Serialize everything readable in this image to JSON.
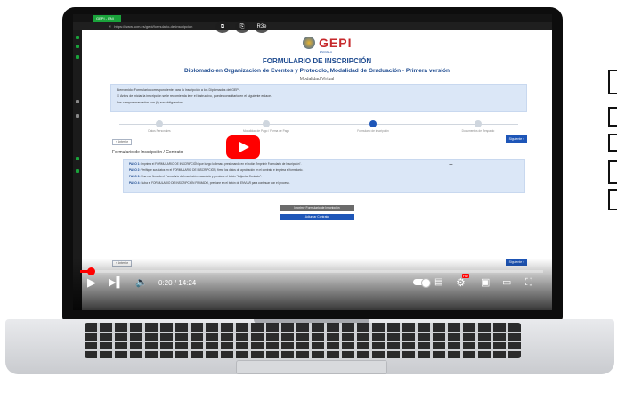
{
  "browser": {
    "tab_label": "GEPI - ENI",
    "url": "©   https://www.ucm.es/gepi/formulario-de-inscripcion"
  },
  "page": {
    "logo_text": "GEPI",
    "logo_sub": "ESCUELA",
    "form_title": "FORMULARIO DE INSCRIPCIÓN",
    "program_title": "Diplomado en Organización de Eventos y Protocolo, Modalidad de Graduación - Primera versión",
    "modality": "Modalidad Virtual",
    "info_lines": [
      "Bienvenido: Formulario correspondiente para la Inscripción a los Diplomados del GEPI.",
      "☐ Antes de iniciar la inscripción se le recomienda leer el Instructivo, puede consultarlo en el siguiente enlace.",
      "Los campos marcados con (*) son obligatorios."
    ],
    "steps": [
      {
        "label": "Datos Personales"
      },
      {
        "label": "Modalidad de Pago / Forma de Pago"
      },
      {
        "label": "Formulario de inscripción"
      },
      {
        "label": "Documentos de Respaldo"
      }
    ],
    "prev_label": "‹ Anterior",
    "next_label": "Siguiente ›",
    "section_heading": "Formulario de Inscripción / Contrato",
    "paso_lines": [
      {
        "tag": "PASO 1:",
        "text": "Imprima el FORMULARIO DE INSCRIPCIÓN que luego lo llenará presionando en el botón \"Imprimir Formulario de Inscripción\"."
      },
      {
        "tag": "PASO 2:",
        "text": "Verifique sus datos en el FORMULARIO DE INSCRIPCIÓN, firme los datos de aprobación en el contrato e imprima el formulario."
      },
      {
        "tag": "PASO 3:",
        "text": "Una vez firmado el Formulario de Inscripción escanéelo y presione el botón \"Adjuntar Contrato\"."
      },
      {
        "tag": "PASO 4:",
        "text": "Suba el FORMULARIO DE INSCRIPCIÓN FIRMADO, presione en el botón de ENVIAR para continuar con el proceso."
      }
    ],
    "btn_print_label": "Imprimir Formulario de Inscripción",
    "btn_attach_label": "Adjuntar Contrato"
  },
  "overlay": {
    "top_icons": [
      "⧉",
      "⎘",
      "R3e"
    ],
    "time_display": "0:20 / 14:24",
    "hd_badge": "HD",
    "progress_fraction": 0.024
  },
  "colors": {
    "accent_blue": "#1e56b8",
    "youtube_red": "#ff0000",
    "info_box": "#dbe7f7"
  }
}
